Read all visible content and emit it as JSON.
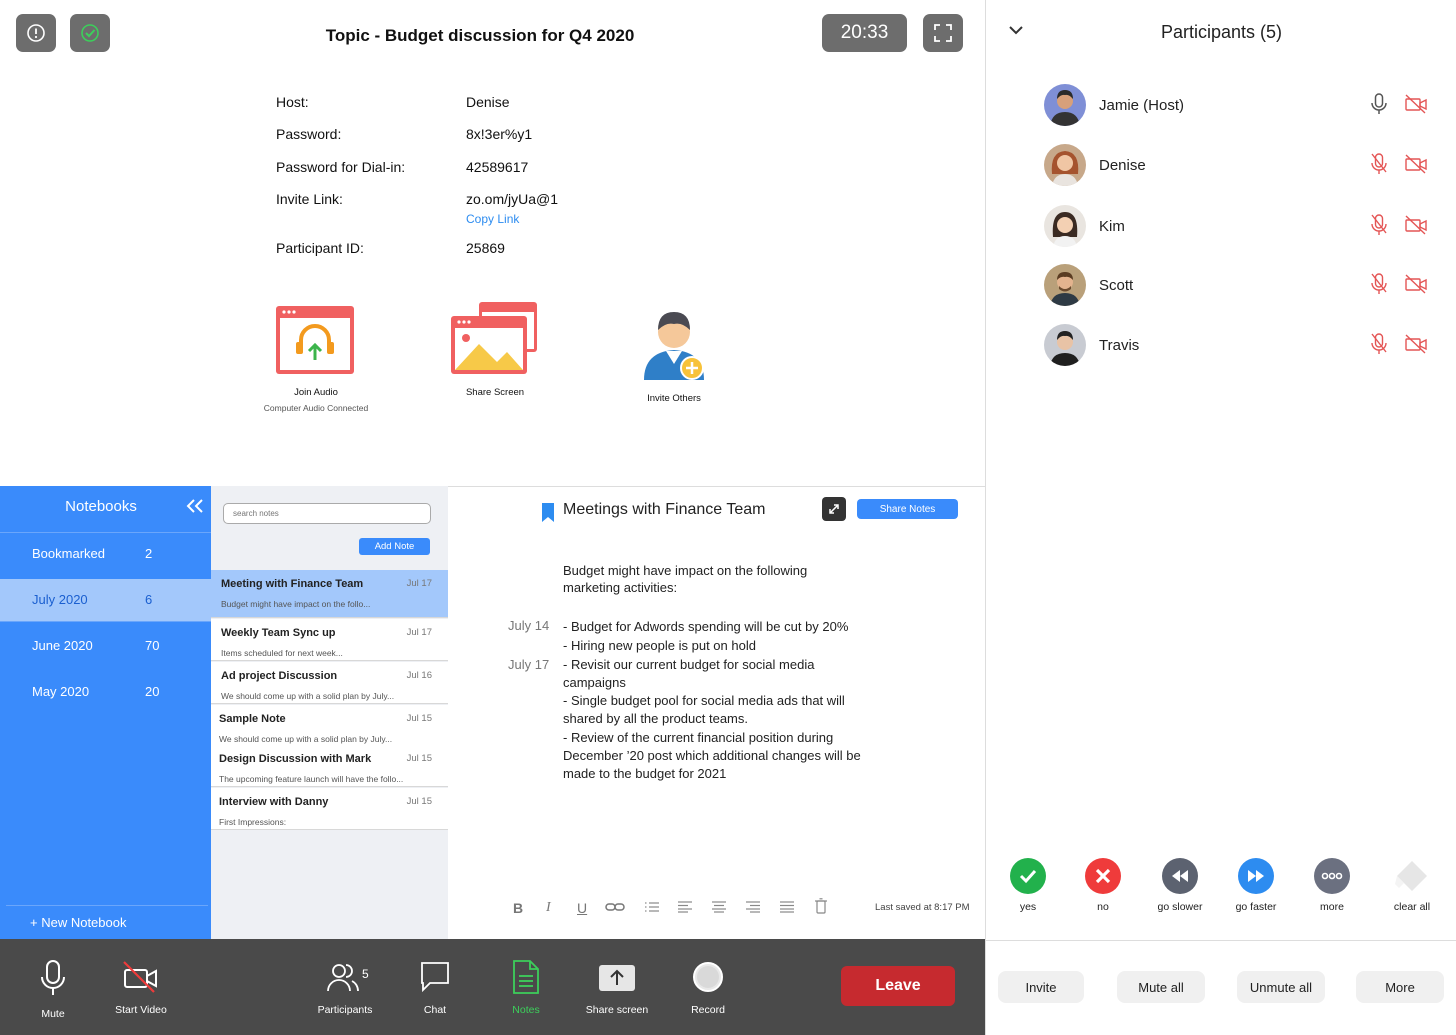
{
  "meeting": {
    "topic": "Topic - Budget discussion for Q4 2020",
    "timer": "20:33",
    "info": [
      {
        "label": "Host:",
        "value": "Denise"
      },
      {
        "label": "Password:",
        "value": "8x!3er%y1"
      },
      {
        "label": "Password for Dial-in:",
        "value": "42589617"
      },
      {
        "label": "Invite Link:",
        "value": "zo.om/jyUa@1"
      },
      {
        "label": "Participant ID:",
        "value": "25869"
      }
    ],
    "copy_link": "Copy Link",
    "actions": [
      {
        "title": "Join Audio",
        "subtitle": "Computer Audio Connected",
        "icon": "join-audio-icon"
      },
      {
        "title": "Share Screen",
        "subtitle": "",
        "icon": "share-screen-icon"
      },
      {
        "title": "Invite Others",
        "subtitle": "",
        "icon": "invite-others-icon"
      }
    ]
  },
  "participants": {
    "title": "Participants (5)",
    "list": [
      {
        "name": "Jamie (Host)",
        "mic": "on",
        "avatar_color": "#7f8fd6"
      },
      {
        "name": "Denise",
        "mic": "muted",
        "avatar_color": "#b86b4a"
      },
      {
        "name": "Kim",
        "mic": "muted",
        "avatar_color": "#d9b49a"
      },
      {
        "name": "Scott",
        "mic": "muted",
        "avatar_color": "#8a6a48"
      },
      {
        "name": "Travis",
        "mic": "muted",
        "avatar_color": "#a9acb3"
      }
    ],
    "reactions": [
      {
        "label": "yes",
        "color": "#22b14c"
      },
      {
        "label": "no",
        "color": "#ef3b3b"
      },
      {
        "label": "go slower",
        "color": "#5c6270"
      },
      {
        "label": "go faster",
        "color": "#2d8cf0"
      },
      {
        "label": "more",
        "color": "#6b7080"
      },
      {
        "label": "clear all",
        "color": "#e4e4e4"
      }
    ],
    "buttons": [
      "Invite",
      "Mute all",
      "Unmute all",
      "More"
    ]
  },
  "notebooks": {
    "title": "Notebooks",
    "items": [
      {
        "label": "Bookmarked",
        "count": "2"
      },
      {
        "label": "July 2020",
        "count": "6"
      },
      {
        "label": "June 2020",
        "count": "70"
      },
      {
        "label": "May 2020",
        "count": "20"
      }
    ],
    "new_notebook": "+ New Notebook"
  },
  "notes": {
    "search_placeholder": "search notes",
    "add_note": "Add Note",
    "list": [
      {
        "title": "Meeting with Finance Team",
        "date": "Jul 17",
        "snippet": "Budget might have impact on the follo..."
      },
      {
        "title": "Weekly Team Sync up",
        "date": "Jul 17",
        "snippet": "Items scheduled for next week..."
      },
      {
        "title": "Ad project Discussion",
        "date": "Jul 16",
        "snippet": "We should come up with a solid plan by July..."
      },
      {
        "title": "Sample Note",
        "date": "Jul 15",
        "snippet": "We should come up with a solid plan by July..."
      },
      {
        "title": "Design Discussion with Mark",
        "date": "Jul 15",
        "snippet": "The upcoming feature launch will have the follo..."
      },
      {
        "title": "Interview with Danny",
        "date": "Jul 15",
        "snippet": "First Impressions:"
      }
    ]
  },
  "editor": {
    "title": "Meetings with Finance Team",
    "share_notes": "Share Notes",
    "lines": [
      "Budget might have impact on the following",
      "marketing activities:",
      "- Budget for Adwords spending will be cut by 20%",
      "- Hiring new people is put on hold",
      "- Revisit our current budget for social media",
      "campaigns",
      "- Single budget pool for social media ads that will",
      "shared by all the product teams.",
      "- Review of the current financial position during",
      "December ’20 post which additional changes will be",
      "made to the budget for 2021"
    ],
    "dates": [
      "July 14",
      "July 17"
    ],
    "format_glyphs": [
      "B",
      "I",
      "U"
    ],
    "last_saved": "Last saved at 8:17 PM"
  },
  "toolbar": {
    "tools": [
      {
        "label": "Mute",
        "icon": "microphone-icon"
      },
      {
        "label": "Start Video",
        "icon": "video-off-icon"
      },
      {
        "label": "Participants",
        "icon": "participants-icon",
        "badge": "5"
      },
      {
        "label": "Chat",
        "icon": "chat-icon"
      },
      {
        "label": "Notes",
        "icon": "notes-icon"
      },
      {
        "label": "Share screen",
        "icon": "share-screen-arrow-icon"
      },
      {
        "label": "Record",
        "icon": "record-icon"
      }
    ],
    "leave": "Leave"
  },
  "colors": {
    "accent": "#3a8bfb",
    "toolbar_bg": "#4a4a4a",
    "leave": "#c62a2f",
    "muted_red": "#e45555",
    "notes_active": "#3ccf5b"
  }
}
